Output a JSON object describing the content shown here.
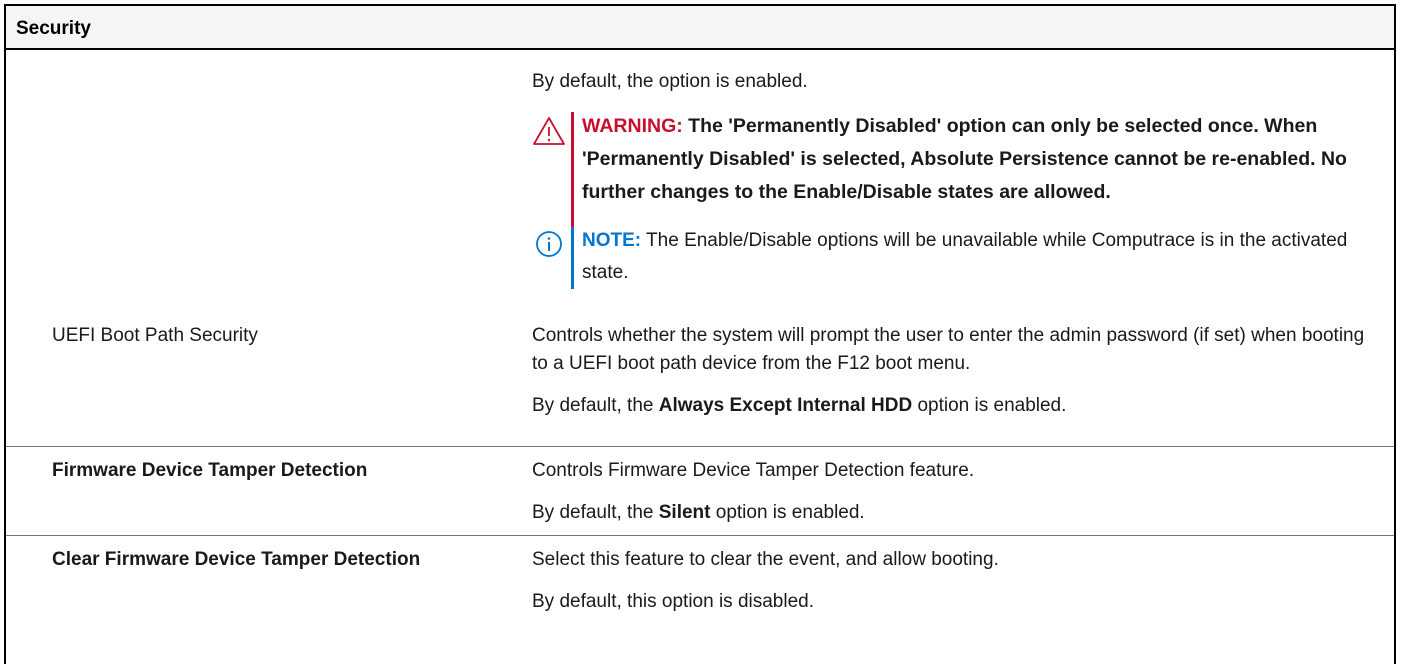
{
  "table": {
    "title": "Security",
    "intro": {
      "default_text": "By default, the option is enabled.",
      "warning": {
        "label": "WARNING:",
        "text": "The 'Permanently Disabled' option can only be selected once. When 'Permanently Disabled' is selected, Absolute Persistence cannot be re-enabled. No further changes to the Enable/Disable states are allowed."
      },
      "note": {
        "label": "NOTE:",
        "text": "The Enable/Disable options will be unavailable while Computrace is in the activated state."
      }
    },
    "rows": [
      {
        "option": "UEFI Boot Path Security",
        "description": "Controls whether the system will prompt the user to enter the admin password (if set) when booting to a UEFI boot path device from the F12 boot menu.",
        "default_prefix": "By default, the ",
        "default_value": "Always Except Internal HDD",
        "default_suffix": " option is enabled."
      },
      {
        "option": "Firmware Device Tamper Detection",
        "description": "Controls Firmware Device Tamper Detection feature.",
        "default_prefix": "By default, the ",
        "default_value": "Silent",
        "default_suffix": " option is enabled."
      },
      {
        "option": "Clear Firmware Device Tamper Detection",
        "description": "Select this feature to clear the event, and allow booting.",
        "default_text": "By default, this option is disabled."
      }
    ]
  },
  "colors": {
    "warning": "#c8102e",
    "note": "#0076ce"
  },
  "icons": {
    "warning": "warning-triangle-icon",
    "note": "info-circle-icon"
  }
}
